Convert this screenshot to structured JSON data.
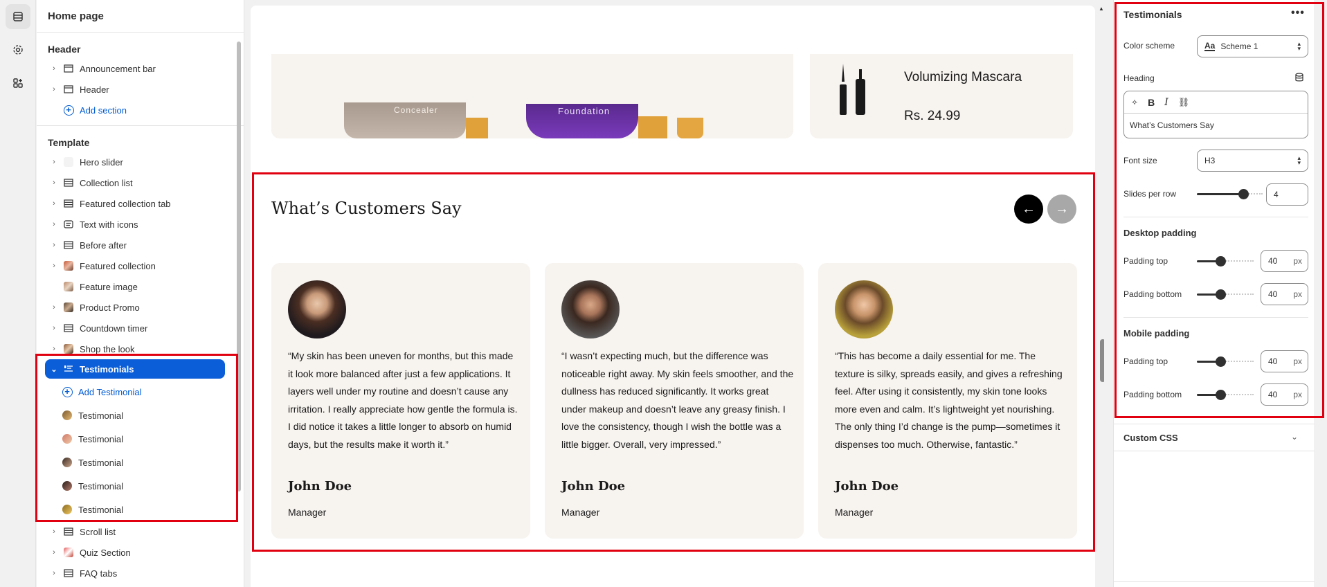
{
  "sidebar": {
    "title": "Home page",
    "header_group": {
      "title": "Header",
      "items": [
        {
          "label": "Announcement bar"
        },
        {
          "label": "Header"
        }
      ],
      "add_label": "Add section"
    },
    "template_group": {
      "title": "Template",
      "items": [
        {
          "label": "Hero slider"
        },
        {
          "label": "Collection list"
        },
        {
          "label": "Featured collection tab"
        },
        {
          "label": "Text with icons"
        },
        {
          "label": "Before after"
        },
        {
          "label": "Featured collection"
        },
        {
          "label": "Feature image"
        },
        {
          "label": "Product Promo"
        },
        {
          "label": "Countdown timer"
        },
        {
          "label": "Shop the look"
        },
        {
          "label": "Testimonials"
        }
      ],
      "testimonial_children": {
        "add_label": "Add Testimonial",
        "items": [
          "Testimonial",
          "Testimonial",
          "Testimonial",
          "Testimonial",
          "Testimonial"
        ]
      },
      "after_items": [
        {
          "label": "Scroll list"
        },
        {
          "label": "Quiz Section"
        },
        {
          "label": "FAQ tabs"
        }
      ]
    }
  },
  "preview": {
    "bottle_labels": [
      "Concealer",
      "Foundation"
    ],
    "featured_product": {
      "title": "Volumizing Mascara",
      "price": "Rs. 24.99"
    },
    "testimonials": {
      "heading": "What’s Customers Say",
      "cards": [
        {
          "quote": "“My skin has been uneven for months, but this made it look more balanced after just a few applications. It layers well under my routine and doesn’t cause any irritation. I really appreciate how gentle the formula is. I did notice it takes a little longer to absorb on humid days, but the results make it worth it.”",
          "name": "John Doe",
          "role": "Manager"
        },
        {
          "quote": "“I wasn’t expecting much, but the difference was noticeable right away. My skin feels smoother, and the dullness has reduced significantly. It works great under makeup and doesn’t leave any greasy finish. I love the consistency, though I wish the bottle was a little bigger. Overall, very impressed.”",
          "name": "John Doe",
          "role": "Manager"
        },
        {
          "quote": "“This has become a daily essential for me. The texture is silky, spreads easily, and gives a refreshing feel. After using it consistently, my skin tone looks more even and calm. It’s lightweight yet nourishing. The only thing I’d change is the pump—sometimes it dispenses too much. Otherwise, fantastic.”",
          "name": "John Doe",
          "role": "Manager"
        }
      ]
    }
  },
  "settings": {
    "title": "Testimonials",
    "more_label": "•••",
    "color_scheme": {
      "label": "Color scheme",
      "value": "Scheme 1",
      "swatch_text": "Aa"
    },
    "heading": {
      "label": "Heading",
      "value": "What’s Customers Say"
    },
    "font_size": {
      "label": "Font size",
      "value": "H3"
    },
    "slides_per_row": {
      "label": "Slides per row",
      "value": "4",
      "fraction": 0.75
    },
    "desktop_padding": {
      "title": "Desktop padding",
      "top": {
        "label": "Padding top",
        "value": "40",
        "unit": "px",
        "fraction": 0.4
      },
      "bottom": {
        "label": "Padding bottom",
        "value": "40",
        "unit": "px",
        "fraction": 0.4
      }
    },
    "mobile_padding": {
      "title": "Mobile padding",
      "top": {
        "label": "Padding top",
        "value": "40",
        "unit": "px",
        "fraction": 0.4
      },
      "bottom": {
        "label": "Padding bottom",
        "value": "40",
        "unit": "px",
        "fraction": 0.4
      }
    },
    "custom_css": {
      "label": "Custom CSS"
    }
  },
  "colors": {
    "accent": "#0b5ed7",
    "annotation": "#e0000f",
    "card_bg": "#f7f3ef"
  }
}
